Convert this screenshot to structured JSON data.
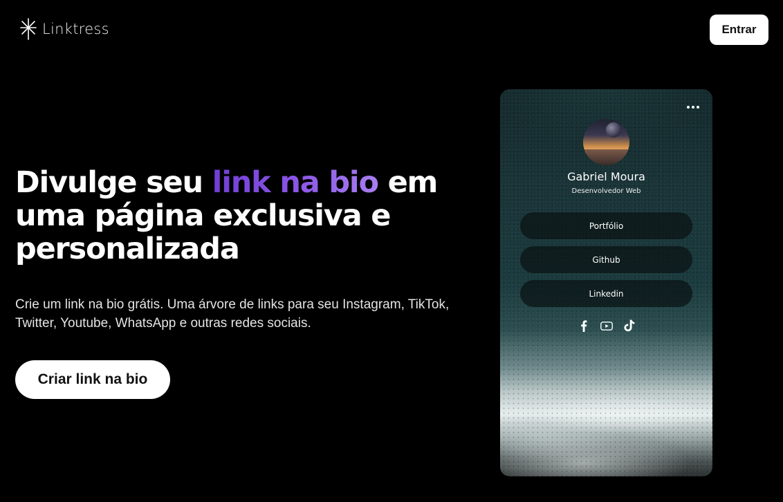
{
  "header": {
    "logo_text": "Linktress",
    "login_label": "Entrar"
  },
  "hero": {
    "title_before": "Divulge seu ",
    "title_accent": "link na bio",
    "title_after": " em uma página exclusiva e personalizada",
    "subtitle": "Crie um link na bio grátis. Uma árvore de links para seu Instagram, TikTok, Twitter, Youtube, WhatsApp e outras redes sociais.",
    "cta_label": "Criar link na bio"
  },
  "preview": {
    "name": "Gabriel Moura",
    "role": "Desenvolvedor Web",
    "links": [
      {
        "label": "Portfólio"
      },
      {
        "label": "Github"
      },
      {
        "label": "Linkedin"
      }
    ],
    "socials": [
      "facebook-icon",
      "youtube-icon",
      "tiktok-icon"
    ]
  },
  "colors": {
    "background": "#000000",
    "accent_start": "#6f3fd4",
    "accent_end": "#a87ef0",
    "button_bg": "#ffffff",
    "button_text": "#111111"
  }
}
